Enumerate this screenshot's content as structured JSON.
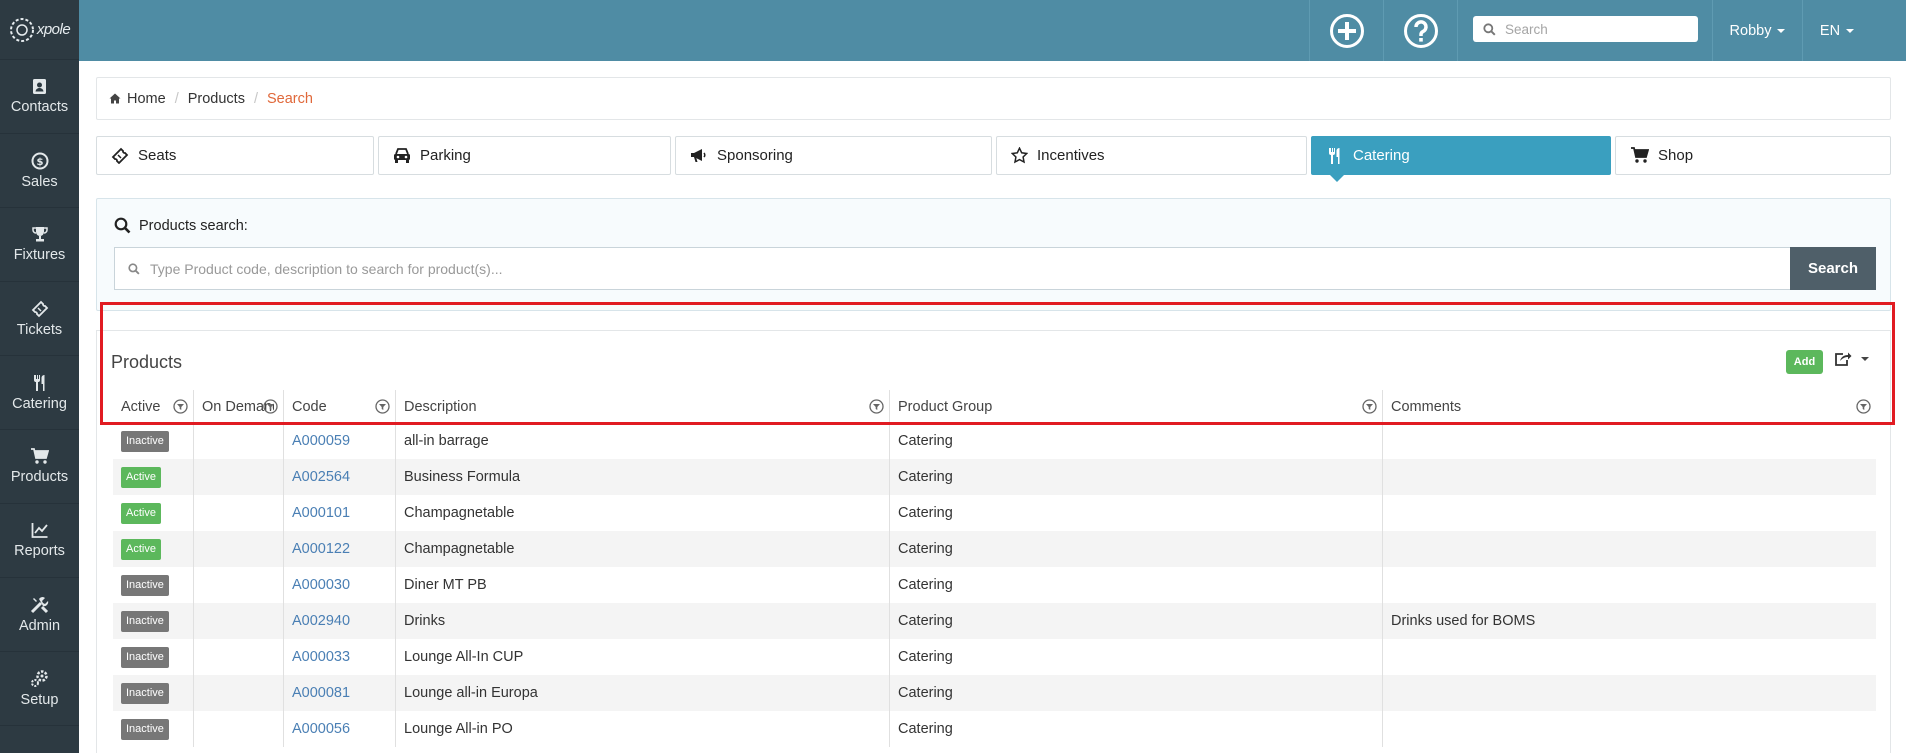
{
  "app": {
    "logo_text": "xpole"
  },
  "sidebar": {
    "items": [
      {
        "label": "Contacts",
        "icon": "contacts-icon"
      },
      {
        "label": "Sales",
        "icon": "dollar-icon"
      },
      {
        "label": "Fixtures",
        "icon": "trophy-icon"
      },
      {
        "label": "Tickets",
        "icon": "ticket-icon"
      },
      {
        "label": "Catering",
        "icon": "fork-knife-icon"
      },
      {
        "label": "Products",
        "icon": "cart-icon"
      },
      {
        "label": "Reports",
        "icon": "chart-icon"
      },
      {
        "label": "Admin",
        "icon": "tools-icon"
      },
      {
        "label": "Setup",
        "icon": "gears-icon"
      }
    ]
  },
  "topbar": {
    "search_placeholder": "Search",
    "user": "Robby",
    "language": "EN"
  },
  "breadcrumb": {
    "home": "Home",
    "products": "Products",
    "current": "Search"
  },
  "tabs": [
    {
      "label": "Seats",
      "icon": "ticket-icon"
    },
    {
      "label": "Parking",
      "icon": "car-icon"
    },
    {
      "label": "Sponsoring",
      "icon": "megaphone-icon"
    },
    {
      "label": "Incentives",
      "icon": "star-icon"
    },
    {
      "label": "Catering",
      "icon": "fork-knife-icon",
      "active": true
    },
    {
      "label": "Shop",
      "icon": "cart-icon"
    }
  ],
  "search_panel": {
    "title": "Products search:",
    "placeholder": "Type Product code, description to search for product(s)...",
    "button": "Search"
  },
  "products": {
    "title": "Products",
    "add_label": "Add",
    "columns": [
      "Active",
      "On Demand",
      "Code",
      "Description",
      "Product Group",
      "Comments"
    ],
    "rows": [
      {
        "status": "Inactive",
        "on_demand": "",
        "code": "A000059",
        "description": "all-in barrage",
        "group": "Catering",
        "comments": ""
      },
      {
        "status": "Active",
        "on_demand": "",
        "code": "A002564",
        "description": "Business Formula",
        "group": "Catering",
        "comments": ""
      },
      {
        "status": "Active",
        "on_demand": "",
        "code": "A000101",
        "description": "Champagnetable",
        "group": "Catering",
        "comments": ""
      },
      {
        "status": "Active",
        "on_demand": "",
        "code": "A000122",
        "description": "Champagnetable",
        "group": "Catering",
        "comments": ""
      },
      {
        "status": "Inactive",
        "on_demand": "",
        "code": "A000030",
        "description": "Diner MT PB",
        "group": "Catering",
        "comments": ""
      },
      {
        "status": "Inactive",
        "on_demand": "",
        "code": "A002940",
        "description": "Drinks",
        "group": "Catering",
        "comments": "Drinks used for BOMS"
      },
      {
        "status": "Inactive",
        "on_demand": "",
        "code": "A000033",
        "description": "Lounge All-In CUP",
        "group": "Catering",
        "comments": ""
      },
      {
        "status": "Inactive",
        "on_demand": "",
        "code": "A000081",
        "description": "Lounge all-in Europa",
        "group": "Catering",
        "comments": ""
      },
      {
        "status": "Inactive",
        "on_demand": "",
        "code": "A000056",
        "description": "Lounge All-in PO",
        "group": "Catering",
        "comments": ""
      }
    ]
  },
  "colors": {
    "topbar": "#4f8ca4",
    "sidebar": "#2d3a42",
    "active_tab": "#3a9fbf",
    "active_badge": "#5cb85c",
    "inactive_badge": "#777777",
    "highlight": "#e11b22",
    "breadcrumb_current": "#e0683a"
  }
}
